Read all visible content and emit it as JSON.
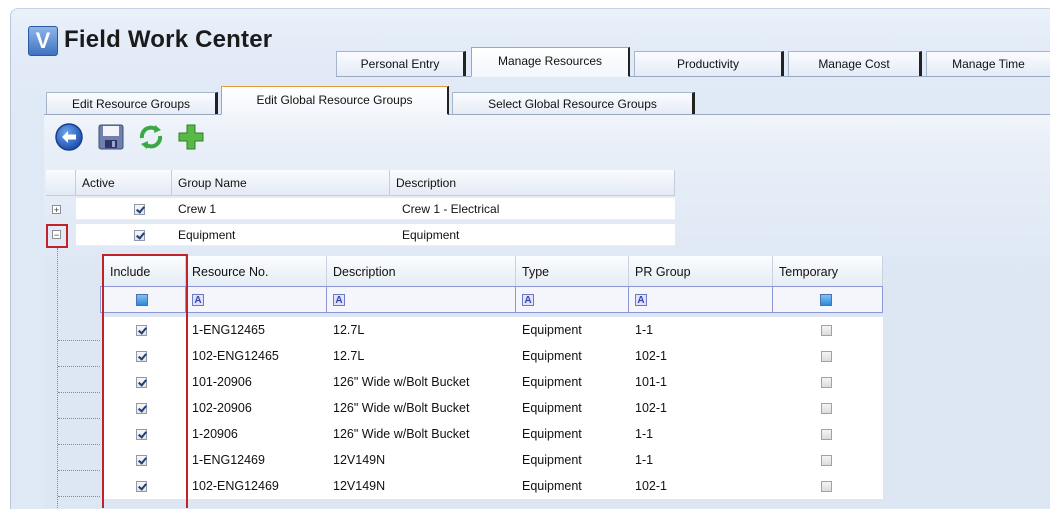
{
  "app": {
    "logo_letter": "V",
    "title": "Field Work Center"
  },
  "main_tabs": [
    {
      "label": "Personal Entry",
      "active": false
    },
    {
      "label": "Manage Resources",
      "active": true
    },
    {
      "label": "Productivity",
      "active": false
    },
    {
      "label": "Manage Cost",
      "active": false
    },
    {
      "label": "Manage Time",
      "active": false
    }
  ],
  "sub_tabs": [
    {
      "label": "Edit Resource Groups",
      "active": false
    },
    {
      "label": "Edit Global Resource Groups",
      "active": true
    },
    {
      "label": "Select Global Resource Groups",
      "active": false
    }
  ],
  "toolbar": {
    "icons": [
      "back-arrow-icon",
      "save-icon",
      "refresh-icon",
      "add-icon"
    ]
  },
  "groups_grid": {
    "columns": [
      "Active",
      "Group Name",
      "Description"
    ],
    "rows": [
      {
        "active": true,
        "name": "Crew 1",
        "description": "Crew 1 - Electrical",
        "expanded": false
      },
      {
        "active": true,
        "name": "Equipment",
        "description": "Equipment",
        "expanded": true
      }
    ]
  },
  "resources_grid": {
    "columns": [
      "Include",
      "Resource No.",
      "Description",
      "Type",
      "PR Group",
      "Temporary"
    ],
    "filter_glyph": "A",
    "rows": [
      {
        "include": true,
        "resource_no": "1-ENG12465",
        "description": "12.7L",
        "type": "Equipment",
        "pr_group": "1-1",
        "temporary": false
      },
      {
        "include": true,
        "resource_no": "102-ENG12465",
        "description": "12.7L",
        "type": "Equipment",
        "pr_group": "102-1",
        "temporary": false
      },
      {
        "include": true,
        "resource_no": "101-20906",
        "description": "126\" Wide w/Bolt Bucket",
        "type": "Equipment",
        "pr_group": "101-1",
        "temporary": false
      },
      {
        "include": true,
        "resource_no": "102-20906",
        "description": "126\" Wide w/Bolt Bucket",
        "type": "Equipment",
        "pr_group": "102-1",
        "temporary": false
      },
      {
        "include": true,
        "resource_no": "1-20906",
        "description": "126\" Wide w/Bolt Bucket",
        "type": "Equipment",
        "pr_group": "1-1",
        "temporary": false
      },
      {
        "include": true,
        "resource_no": "1-ENG12469",
        "description": "12V149N",
        "type": "Equipment",
        "pr_group": "1-1",
        "temporary": false
      },
      {
        "include": true,
        "resource_no": "102-ENG12469",
        "description": "12V149N",
        "type": "Equipment",
        "pr_group": "102-1",
        "temporary": false
      }
    ]
  },
  "colors": {
    "accent_tab": "#e39a3d",
    "highlight_box": "#c0222a",
    "filter_border": "#8e97d6"
  }
}
